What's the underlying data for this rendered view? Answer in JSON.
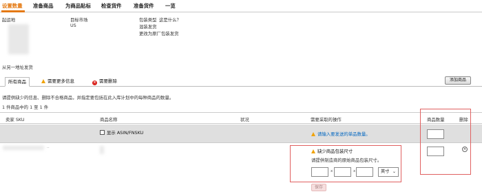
{
  "steps": [
    "设置数量",
    "准备商品",
    "为商品贴标",
    "检查货件",
    "准备货件",
    "一览"
  ],
  "shipment": {
    "from_label": "起运地",
    "market_label": "目标市场",
    "market_value": "US",
    "packing_label": "包装类型",
    "packing_link": "这是什么？",
    "packing_value": "混装发货",
    "change_link": "更改为原厂包装发货",
    "ship_other_link": "从另一地址发货"
  },
  "tabs": {
    "all": "所有商品",
    "need_info": "需要更多信息",
    "need_remove": "需要删除"
  },
  "add_button": "添加商品",
  "instruction": "请提供缺少的信息、删除不合格商品，并指定要包括在此入库计划中的每种商品的数量。",
  "count_text": "1 件商品中的 1 至 1 件",
  "columns": {
    "sku": "卖家 SKU",
    "name": "商品名称",
    "status": "状况",
    "action": "需要采取的操作",
    "qty": "商品数量",
    "delete": "删除"
  },
  "row1": {
    "show_asin_label": "显示 ASIN/FNSKU",
    "action_text": "请输入要发送的单品数量。"
  },
  "row2": {
    "sku_partial": "..",
    "missing_title": "缺少商品包装尺寸",
    "missing_desc": "请提供制造商的原始商品包装尺寸。",
    "times": "x",
    "unit": "英寸",
    "save": "保存",
    "delete_icon": "×"
  },
  "colors": {
    "accent": "#e47911",
    "link": "#0066c0",
    "warn": "#f0a30a",
    "error": "#d9221c"
  }
}
